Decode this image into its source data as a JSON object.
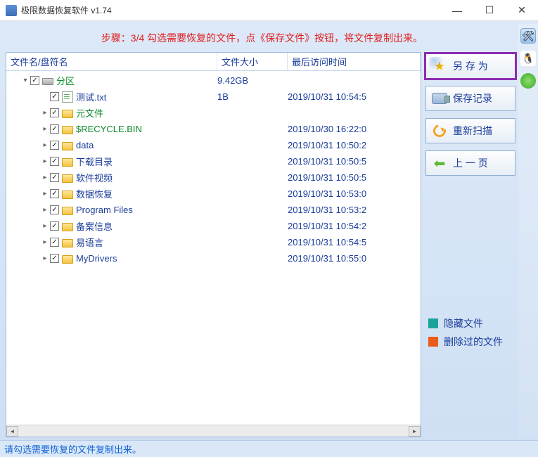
{
  "window": {
    "title": "极限数据恢复软件 v1.74"
  },
  "step_message": "步骤：3/4 勾选需要恢复的文件，点《保存文件》按钮，将文件复制出来。",
  "columns": {
    "name": "文件名/盘符名",
    "size": "文件大小",
    "date": "最后访问时间"
  },
  "rows": [
    {
      "indent": 0,
      "expander": "v",
      "checked": true,
      "icon": "drive",
      "label": "分区",
      "green": true,
      "size": "9.42GB",
      "date": ""
    },
    {
      "indent": 1,
      "expander": "",
      "checked": true,
      "icon": "txt",
      "label": "测试.txt",
      "green": false,
      "size": "1B",
      "date": "2019/10/31 10:54:5"
    },
    {
      "indent": 1,
      "expander": ">",
      "checked": true,
      "icon": "folder",
      "label": "元文件",
      "green": true,
      "size": "",
      "date": ""
    },
    {
      "indent": 1,
      "expander": ">",
      "checked": true,
      "icon": "folder",
      "label": "$RECYCLE.BIN",
      "green": true,
      "size": "",
      "date": "2019/10/30 16:22:0"
    },
    {
      "indent": 1,
      "expander": ">",
      "checked": true,
      "icon": "folder",
      "label": "data",
      "green": false,
      "size": "",
      "date": "2019/10/31 10:50:2"
    },
    {
      "indent": 1,
      "expander": ">",
      "checked": true,
      "icon": "folder",
      "label": "下载目录",
      "green": false,
      "size": "",
      "date": "2019/10/31 10:50:5"
    },
    {
      "indent": 1,
      "expander": ">",
      "checked": true,
      "icon": "folder",
      "label": "软件视频",
      "green": false,
      "size": "",
      "date": "2019/10/31 10:50:5"
    },
    {
      "indent": 1,
      "expander": ">",
      "checked": true,
      "icon": "folder",
      "label": "数据恢复",
      "green": false,
      "size": "",
      "date": "2019/10/31 10:53:0"
    },
    {
      "indent": 1,
      "expander": ">",
      "checked": true,
      "icon": "folder",
      "label": "Program Files",
      "green": false,
      "size": "",
      "date": "2019/10/31 10:53:2"
    },
    {
      "indent": 1,
      "expander": ">",
      "checked": true,
      "icon": "folder",
      "label": "备案信息",
      "green": false,
      "size": "",
      "date": "2019/10/31 10:54:2"
    },
    {
      "indent": 1,
      "expander": ">",
      "checked": true,
      "icon": "folder",
      "label": "易语言",
      "green": false,
      "size": "",
      "date": "2019/10/31 10:54:5"
    },
    {
      "indent": 1,
      "expander": ">",
      "checked": true,
      "icon": "folder",
      "label": "MyDrivers",
      "green": false,
      "size": "",
      "date": "2019/10/31 10:55:0"
    }
  ],
  "buttons": {
    "save_as": "另 存 为",
    "save_log": "保存记录",
    "rescan": "重新扫描",
    "back": "上 一 页"
  },
  "legend": {
    "hidden": "隐藏文件",
    "deleted": "删除过的文件"
  },
  "statusbar": "请勾选需要恢复的文件复制出来。"
}
